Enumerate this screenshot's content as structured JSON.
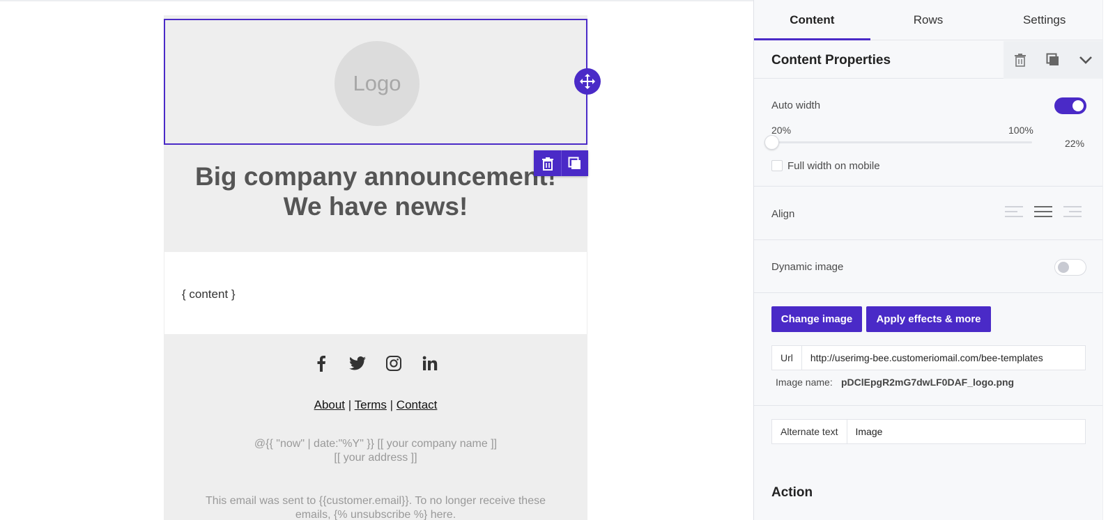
{
  "canvas": {
    "logo_text": "Logo",
    "headline": [
      "Big company announcement!",
      "We have news!"
    ],
    "content_placeholder": "{ content }",
    "social_icons": [
      "facebook-icon",
      "twitter-icon",
      "instagram-icon",
      "linkedin-icon"
    ],
    "links": {
      "about": "About",
      "terms": "Terms",
      "contact": "Contact",
      "separator": "|"
    },
    "address_lines": [
      "@{{ \"now\" | date:\"%Y\" }} [[ your company name ]]",
      "[[ your address ]]"
    ],
    "unsubscribe_lines": [
      "This email was sent to {{customer.email}}. To no longer receive these",
      "emails, {% unsubscribe %} here."
    ]
  },
  "sidebar": {
    "tabs": [
      {
        "label": "Content",
        "active": true
      },
      {
        "label": "Rows",
        "active": false
      },
      {
        "label": "Settings",
        "active": false
      }
    ],
    "properties_title": "Content Properties",
    "auto_width": {
      "label": "Auto width",
      "enabled": true,
      "min_label": "20%",
      "max_label": "100%",
      "value": "22%"
    },
    "full_width_mobile": {
      "label": "Full width on mobile",
      "checked": false
    },
    "align": {
      "label": "Align",
      "options": [
        "left",
        "center",
        "right"
      ],
      "selected": "center"
    },
    "dynamic_image": {
      "label": "Dynamic image",
      "enabled": false
    },
    "buttons": {
      "change_image": "Change image",
      "apply_effects": "Apply effects & more"
    },
    "url": {
      "label": "Url",
      "value": "http://userimg-bee.customeriomail.com/bee-templates"
    },
    "image_name": {
      "label": "Image name:",
      "value": "pDClEpgR2mG7dwLF0DAF_logo.png"
    },
    "alt_text": {
      "label": "Alternate text",
      "value": "Image"
    },
    "action_title": "Action"
  },
  "colors": {
    "accent": "#4a2ac7",
    "email_bg": "#eeeeee",
    "sidebar_bg": "#f7f8fa"
  }
}
